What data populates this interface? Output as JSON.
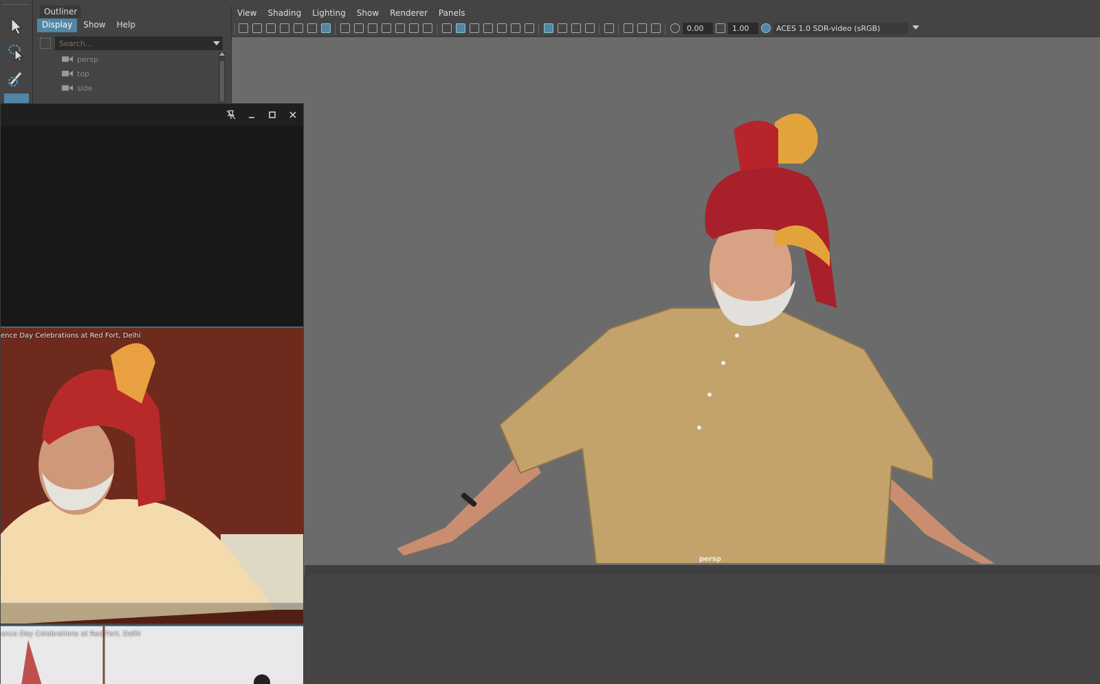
{
  "outliner": {
    "title": "Outliner",
    "menu": [
      "Display",
      "Show",
      "Help"
    ],
    "search_placeholder": "Search...",
    "items": [
      {
        "label": "persp",
        "icon": "camera-icon"
      },
      {
        "label": "top",
        "icon": "camera-icon"
      },
      {
        "label": "side",
        "icon": "camera-icon"
      }
    ]
  },
  "viewport": {
    "menu": [
      "View",
      "Shading",
      "Lighting",
      "Show",
      "Renderer",
      "Panels"
    ],
    "exposure": "0.00",
    "gamma": "1.00",
    "color_space": "ACES 1.0 SDR-video (sRGB)",
    "camera_label": "persp"
  },
  "float_window": {
    "video1_title": "ence Day Celebrations at Red Fort, Delhi",
    "video2_title": "ence Day Celebrations at Red Fort, Delhi"
  },
  "colors": {
    "accent": "#5285a6",
    "viewport_bg": "#6b6b6b",
    "panel_bg": "#444444"
  }
}
